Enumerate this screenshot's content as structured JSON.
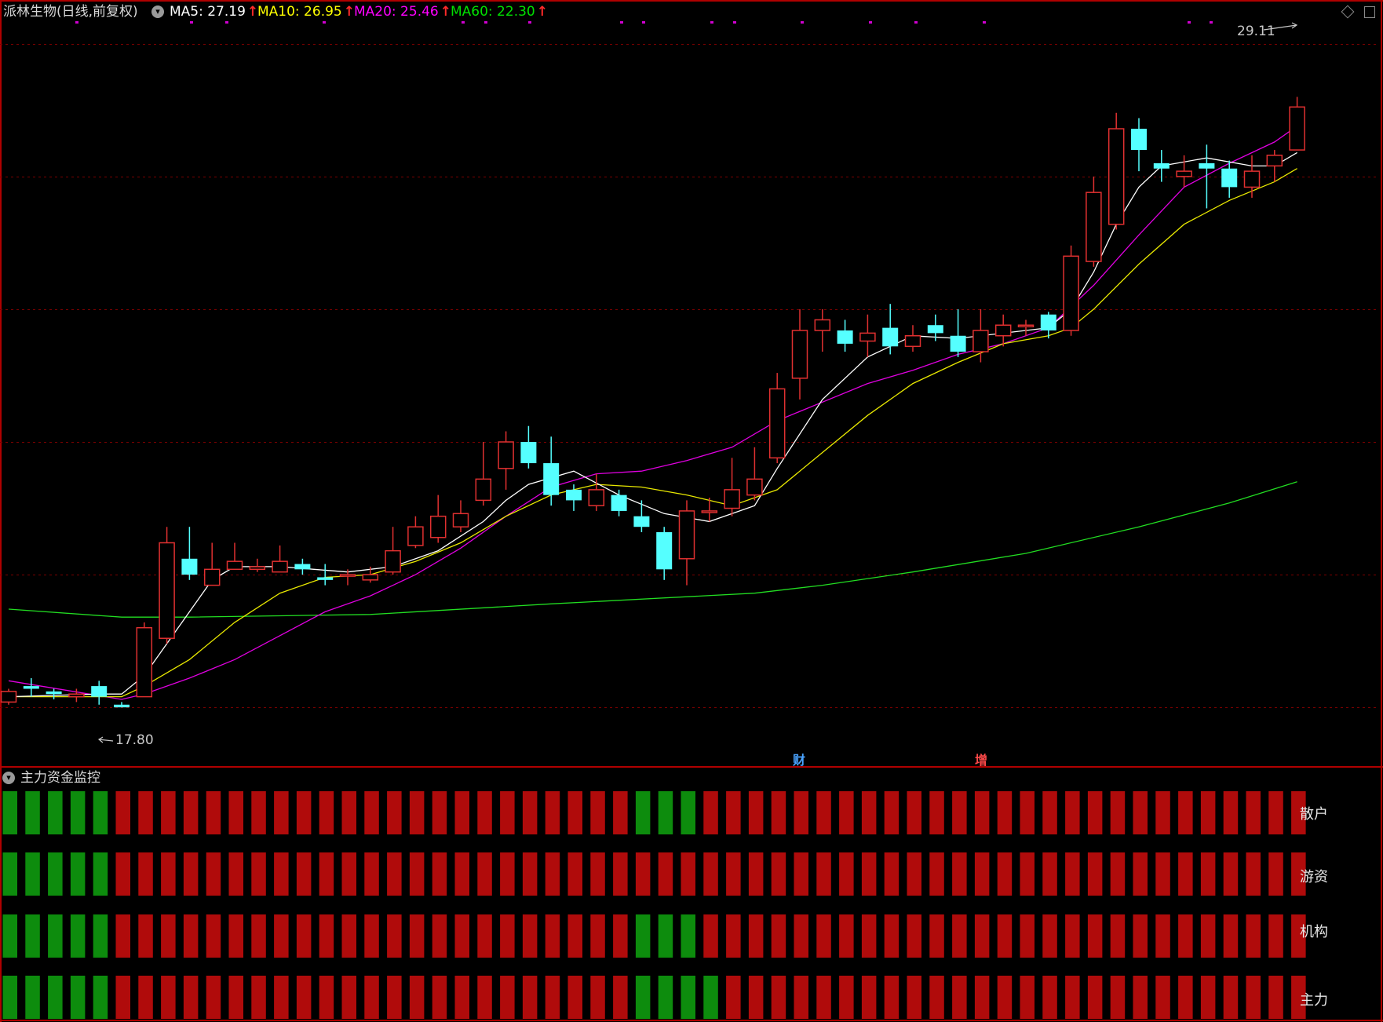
{
  "header": {
    "title": "派林生物(日线,前复权)",
    "ma": [
      {
        "label": "MA5: 27.19",
        "color": "#ffffff"
      },
      {
        "label": "MA10: 26.95",
        "color": "#ffff00"
      },
      {
        "label": "MA20: 25.46",
        "color": "#ff00ff"
      },
      {
        "label": "MA60: 22.30",
        "color": "#00e000"
      }
    ],
    "arrow_glyph": "↑"
  },
  "indicator": {
    "title": "主力资金监控",
    "rows": [
      "散户",
      "游资",
      "机构",
      "主力"
    ]
  },
  "events": [
    {
      "label": "财",
      "color": "#4aa3ff"
    },
    {
      "label": "增",
      "color": "#ff4a4a"
    }
  ],
  "chart_data": [
    {
      "type": "candlestick",
      "title": "派林生物(日线,前复权)",
      "ylim": [
        16.9,
        30.8
      ],
      "gridlines": [
        17.8,
        20.3,
        22.8,
        25.3,
        27.8,
        30.3
      ],
      "colors": {
        "up": "#e03030",
        "down": "#55ffff",
        "ma5": "#ffffff",
        "ma10": "#e8e800",
        "ma20": "#e000e0",
        "ma60": "#22dd22"
      },
      "annotations": [
        {
          "label": "29.11",
          "type": "high"
        },
        {
          "label": "17.80",
          "type": "low"
        }
      ],
      "candles": [
        [
          17.9,
          18.1,
          18.15,
          17.85
        ],
        [
          18.2,
          18.15,
          18.35,
          18.0
        ],
        [
          18.1,
          18.05,
          18.15,
          17.95
        ],
        [
          18.0,
          18.05,
          18.15,
          17.9
        ],
        [
          18.2,
          18.0,
          18.3,
          17.85
        ],
        [
          17.85,
          17.8,
          17.9,
          17.8
        ],
        [
          18.0,
          19.3,
          19.4,
          18.0
        ],
        [
          19.1,
          20.9,
          21.2,
          19.0
        ],
        [
          20.6,
          20.3,
          21.2,
          20.2
        ],
        [
          20.1,
          20.4,
          20.9,
          20.1
        ],
        [
          20.4,
          20.55,
          20.9,
          20.4
        ],
        [
          20.4,
          20.45,
          20.6,
          20.35
        ],
        [
          20.35,
          20.55,
          20.85,
          20.35
        ],
        [
          20.5,
          20.4,
          20.6,
          20.3
        ],
        [
          20.25,
          20.2,
          20.5,
          20.1
        ],
        [
          20.3,
          20.3,
          20.4,
          20.1
        ],
        [
          20.2,
          20.3,
          20.45,
          20.15
        ],
        [
          20.35,
          20.75,
          21.2,
          20.3
        ],
        [
          20.85,
          21.2,
          21.4,
          20.8
        ],
        [
          21.0,
          21.4,
          21.8,
          20.9
        ],
        [
          21.2,
          21.45,
          21.7,
          21.1
        ],
        [
          21.7,
          22.1,
          22.8,
          21.6
        ],
        [
          22.3,
          22.8,
          23.0,
          21.9
        ],
        [
          22.8,
          22.4,
          23.1,
          22.3
        ],
        [
          22.4,
          21.8,
          22.9,
          21.6
        ],
        [
          21.9,
          21.7,
          22.0,
          21.5
        ],
        [
          21.6,
          21.9,
          22.2,
          21.5
        ],
        [
          21.8,
          21.5,
          21.9,
          21.4
        ],
        [
          21.4,
          21.2,
          21.7,
          21.1
        ],
        [
          21.1,
          20.4,
          21.2,
          20.2
        ],
        [
          20.6,
          21.5,
          21.7,
          20.1
        ],
        [
          21.5,
          21.5,
          21.75,
          21.3
        ],
        [
          21.55,
          21.9,
          22.5,
          21.4
        ],
        [
          21.8,
          22.1,
          22.7,
          21.7
        ],
        [
          22.5,
          23.8,
          24.1,
          22.4
        ],
        [
          24.0,
          24.9,
          25.3,
          23.6
        ],
        [
          24.9,
          25.1,
          25.3,
          24.5
        ],
        [
          24.9,
          24.65,
          25.1,
          24.5
        ],
        [
          24.7,
          24.85,
          25.2,
          24.4
        ],
        [
          24.95,
          24.6,
          25.4,
          24.45
        ],
        [
          24.6,
          24.8,
          25.0,
          24.5
        ],
        [
          25.0,
          24.85,
          25.2,
          24.7
        ],
        [
          24.8,
          24.5,
          25.3,
          24.4
        ],
        [
          24.5,
          24.9,
          25.3,
          24.3
        ],
        [
          24.8,
          25.0,
          25.2,
          24.6
        ],
        [
          25.0,
          25.0,
          25.1,
          24.8
        ],
        [
          25.2,
          24.9,
          25.25,
          24.75
        ],
        [
          24.9,
          26.3,
          26.5,
          24.8
        ],
        [
          26.2,
          27.5,
          27.8,
          26.1
        ],
        [
          26.9,
          28.7,
          29.0,
          26.8
        ],
        [
          28.7,
          28.3,
          28.9,
          27.9
        ],
        [
          28.05,
          27.95,
          28.3,
          27.7
        ],
        [
          27.8,
          27.9,
          28.2,
          27.6
        ],
        [
          28.05,
          27.95,
          28.4,
          27.2
        ],
        [
          27.95,
          27.6,
          28.1,
          27.4
        ],
        [
          27.6,
          27.9,
          28.2,
          27.4
        ],
        [
          28.0,
          28.2,
          28.3,
          27.7
        ],
        [
          28.3,
          29.11,
          29.3,
          28.3
        ]
      ],
      "ma5_line": [
        [
          0,
          18.0
        ],
        [
          4,
          18.05
        ],
        [
          5,
          18.05
        ],
        [
          6,
          18.4
        ],
        [
          7,
          19.0
        ],
        [
          8,
          19.6
        ],
        [
          9,
          20.2
        ],
        [
          10,
          20.45
        ],
        [
          12,
          20.45
        ],
        [
          15,
          20.35
        ],
        [
          17,
          20.45
        ],
        [
          19,
          20.75
        ],
        [
          21,
          21.3
        ],
        [
          22,
          21.7
        ],
        [
          23,
          22.0
        ],
        [
          25,
          22.25
        ],
        [
          27,
          21.8
        ],
        [
          29,
          21.45
        ],
        [
          31,
          21.3
        ],
        [
          33,
          21.6
        ],
        [
          34,
          22.3
        ],
        [
          36,
          23.6
        ],
        [
          38,
          24.4
        ],
        [
          40,
          24.8
        ],
        [
          42,
          24.75
        ],
        [
          44,
          24.85
        ],
        [
          46,
          24.95
        ],
        [
          47,
          25.3
        ],
        [
          48,
          26.0
        ],
        [
          49,
          26.9
        ],
        [
          50,
          27.6
        ],
        [
          51,
          28.0
        ],
        [
          53,
          28.15
        ],
        [
          55,
          28.0
        ],
        [
          56,
          28.0
        ],
        [
          57,
          28.25
        ]
      ],
      "ma10_line": [
        [
          0,
          18.0
        ],
        [
          4,
          18.0
        ],
        [
          5,
          18.0
        ],
        [
          6,
          18.2
        ],
        [
          8,
          18.7
        ],
        [
          10,
          19.4
        ],
        [
          12,
          19.95
        ],
        [
          14,
          20.25
        ],
        [
          16,
          20.3
        ],
        [
          18,
          20.55
        ],
        [
          20,
          20.9
        ],
        [
          22,
          21.4
        ],
        [
          24,
          21.8
        ],
        [
          26,
          22.0
        ],
        [
          28,
          21.95
        ],
        [
          30,
          21.8
        ],
        [
          32,
          21.6
        ],
        [
          34,
          21.9
        ],
        [
          36,
          22.6
        ],
        [
          38,
          23.3
        ],
        [
          40,
          23.9
        ],
        [
          42,
          24.3
        ],
        [
          44,
          24.65
        ],
        [
          46,
          24.8
        ],
        [
          47,
          24.95
        ],
        [
          48,
          25.3
        ],
        [
          50,
          26.15
        ],
        [
          52,
          26.9
        ],
        [
          54,
          27.35
        ],
        [
          56,
          27.7
        ],
        [
          57,
          27.95
        ]
      ],
      "ma20_line": [
        [
          0,
          18.3
        ],
        [
          5,
          17.95
        ],
        [
          6,
          18.05
        ],
        [
          8,
          18.35
        ],
        [
          10,
          18.7
        ],
        [
          12,
          19.15
        ],
        [
          14,
          19.6
        ],
        [
          16,
          19.9
        ],
        [
          18,
          20.3
        ],
        [
          20,
          20.8
        ],
        [
          22,
          21.4
        ],
        [
          24,
          21.95
        ],
        [
          26,
          22.2
        ],
        [
          28,
          22.25
        ],
        [
          30,
          22.45
        ],
        [
          32,
          22.7
        ],
        [
          34,
          23.2
        ],
        [
          36,
          23.55
        ],
        [
          38,
          23.9
        ],
        [
          40,
          24.15
        ],
        [
          42,
          24.45
        ],
        [
          44,
          24.65
        ],
        [
          46,
          24.95
        ],
        [
          48,
          25.75
        ],
        [
          50,
          26.7
        ],
        [
          52,
          27.6
        ],
        [
          54,
          28.05
        ],
        [
          56,
          28.45
        ],
        [
          57,
          28.75
        ]
      ],
      "ma60_line": [
        [
          0,
          19.65
        ],
        [
          5,
          19.5
        ],
        [
          8,
          19.5
        ],
        [
          16,
          19.55
        ],
        [
          24,
          19.75
        ],
        [
          33,
          19.95
        ],
        [
          36,
          20.1
        ],
        [
          40,
          20.35
        ],
        [
          45,
          20.7
        ],
        [
          50,
          21.2
        ],
        [
          54,
          21.65
        ],
        [
          57,
          22.05
        ]
      ]
    },
    {
      "type": "heatmap",
      "title": "主力资金监控",
      "rows": [
        "散户",
        "游资",
        "机构",
        "主力"
      ],
      "columns": 58,
      "legend": {
        "G": "#0d8c0d",
        "R": "#b00b0b"
      },
      "cells": [
        "GGGGGRRRRRRRRRRRRRRRRRRRRRRRGGGRRRRRRRRRRRRRRRRRRRRRRRRRRR",
        "GGGGGRRRRRRRRRRRRRRRRRRRRRRRRRRRRRRRRRRRRRRRRRRRRRRRRRRRRR",
        "GGGGGRRRRRRRRRRRRRRRRRRRRRRRGGGRRRRRRRRRRRRRRRRRRRRRRRRRRR",
        "GGGGGRRRRRRRRRRRRRRRRRRRRRRRGGGGRRRRRRRRRRRRRRRRRRRRRRRRRR"
      ]
    }
  ]
}
